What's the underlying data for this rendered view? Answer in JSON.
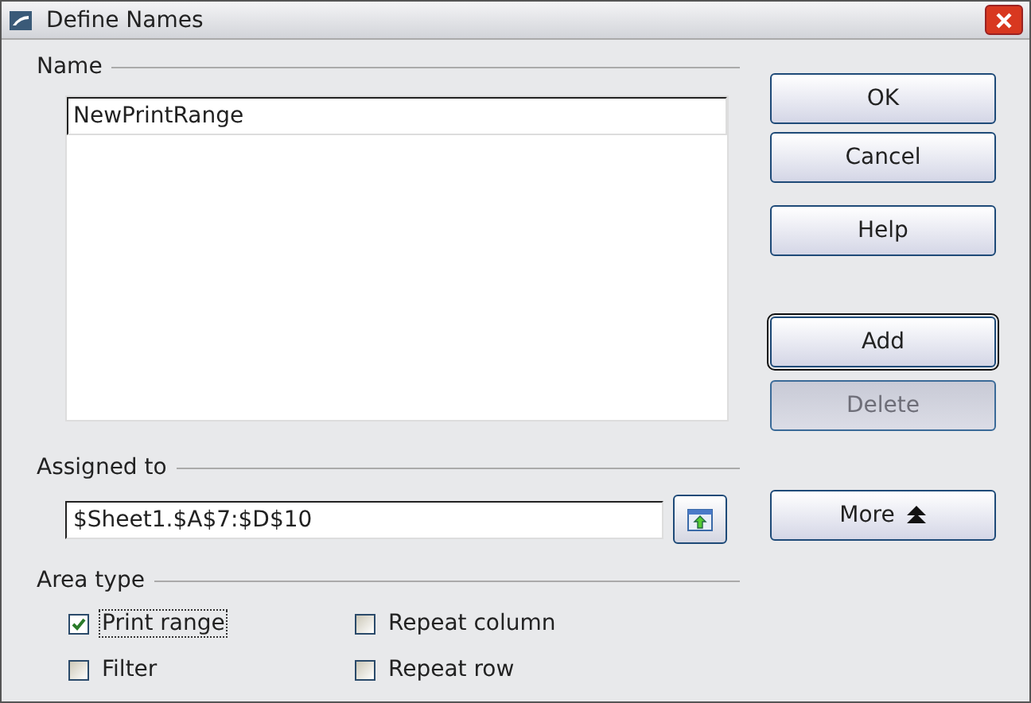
{
  "window": {
    "title": "Define Names"
  },
  "name_section": {
    "label": "Name",
    "value": "NewPrintRange"
  },
  "assigned_section": {
    "label": "Assigned to",
    "value": "$Sheet1.$A$7:$D$10"
  },
  "area_type": {
    "label": "Area type",
    "options": [
      {
        "label": "Print range",
        "checked": true,
        "focused": true
      },
      {
        "label": "Repeat column",
        "checked": false,
        "focused": false
      },
      {
        "label": "Filter",
        "checked": false,
        "focused": false
      },
      {
        "label": "Repeat row",
        "checked": false,
        "focused": false
      }
    ]
  },
  "buttons": [
    {
      "label": "OK",
      "kind": "push",
      "disabled": false,
      "default": false
    },
    {
      "label": "Cancel",
      "kind": "push",
      "disabled": false,
      "default": false
    },
    {
      "label": "Help",
      "kind": "push",
      "disabled": false,
      "default": false
    },
    {
      "label": "Add",
      "kind": "push",
      "disabled": false,
      "default": true
    },
    {
      "label": "Delete",
      "kind": "push",
      "disabled": true,
      "default": false
    },
    {
      "label": "More",
      "kind": "more",
      "disabled": false,
      "default": false
    }
  ]
}
